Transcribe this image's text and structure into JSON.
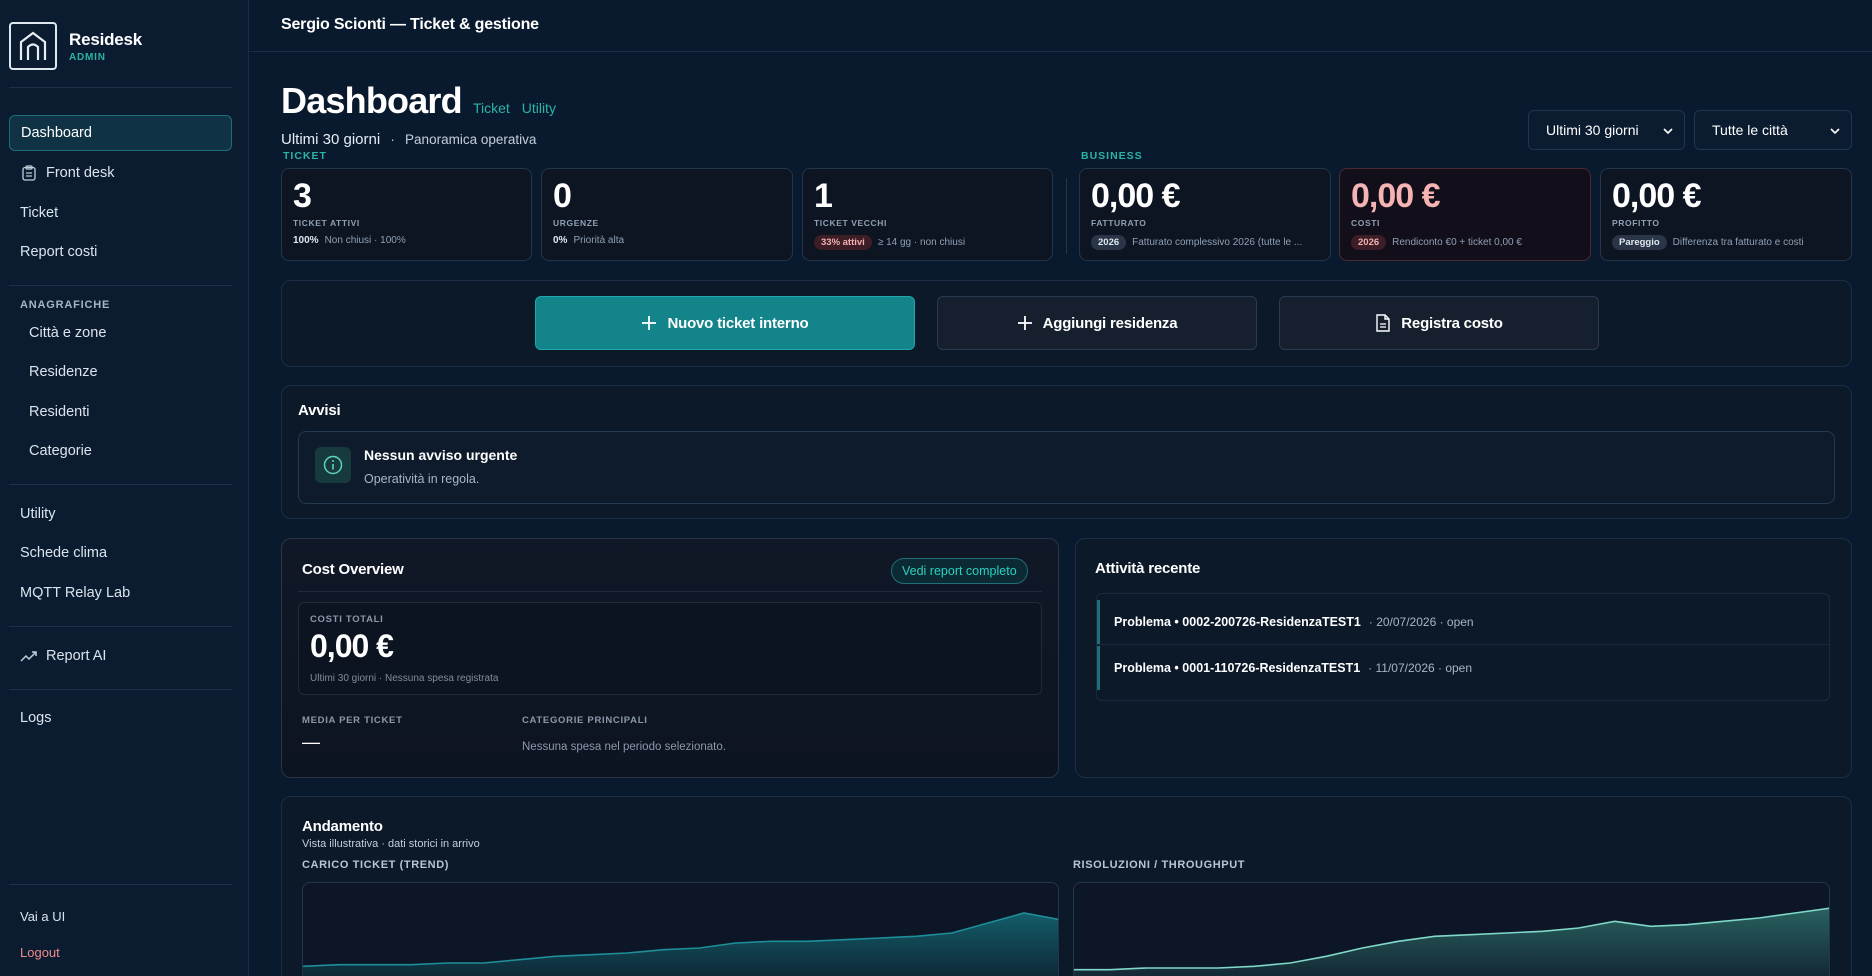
{
  "brand": {
    "name": "Residesk",
    "role": "ADMIN"
  },
  "sidebar": {
    "items": [
      {
        "label": "Dashboard"
      },
      {
        "label": "Front desk"
      },
      {
        "label": "Ticket"
      },
      {
        "label": "Report costi"
      }
    ],
    "anagrafiche_label": "ANAGRAFICHE",
    "anagrafiche": [
      {
        "label": "Città e zone"
      },
      {
        "label": "Residenze"
      },
      {
        "label": "Residenti"
      },
      {
        "label": "Categorie"
      }
    ],
    "utility": [
      {
        "label": "Utility"
      },
      {
        "label": "Schede clima"
      },
      {
        "label": "MQTT Relay Lab"
      }
    ],
    "report_ai": "Report AI",
    "logs": "Logs",
    "vai_ui": "Vai a UI",
    "logout": "Logout"
  },
  "topbar": {
    "title": "Sergio Scionti — Ticket & gestione"
  },
  "header": {
    "title": "Dashboard",
    "links": [
      "Ticket",
      "Utility"
    ],
    "period": "Ultimi 30 giorni",
    "separator": "·",
    "overview": "Panoramica operativa",
    "filter_period": "Ultimi 30 giorni",
    "filter_city": "Tutte le città"
  },
  "sections": {
    "ticket": "TICKET",
    "business": "BUSINESS"
  },
  "kpis": [
    {
      "value": "3",
      "label": "TICKET ATTIVI",
      "strong": "100%",
      "note": "Non chiusi · 100%"
    },
    {
      "value": "0",
      "label": "URGENZE",
      "strong": "0%",
      "note": "Priorità alta"
    },
    {
      "value": "1",
      "label": "TICKET VECCHI",
      "pill": "33% attivi",
      "note": "≥ 14 gg · non chiusi"
    },
    {
      "value": "0,00 €",
      "label": "FATTURATO",
      "pill": "2026",
      "note": "Fatturato complessivo 2026 (tutte le ..."
    },
    {
      "value": "0,00 €",
      "label": "COSTI",
      "pill": "2026",
      "note": "Rendiconto €0 + ticket 0,00 €"
    },
    {
      "value": "0,00 €",
      "label": "PROFITTO",
      "pill": "Pareggio",
      "note": "Differenza tra fatturato e costi"
    }
  ],
  "actions": {
    "new_ticket": "Nuovo ticket interno",
    "add_residence": "Aggiungi residenza",
    "register_cost": "Registra costo"
  },
  "alerts": {
    "title": "Avvisi",
    "item_title": "Nessun avviso urgente",
    "item_text": "Operatività in regola."
  },
  "cost_overview": {
    "title": "Cost Overview",
    "link": "Vedi report completo",
    "total_label": "COSTI TOTALI",
    "total_value": "0,00 €",
    "total_sub": "Ultimi 30 giorni · Nessuna spesa registrata",
    "avg_label": "MEDIA PER TICKET",
    "avg_value": "—",
    "cat_label": "CATEGORIE PRINCIPALI",
    "cat_value": "Nessuna spesa nel periodo selezionato."
  },
  "activity": {
    "title": "Attività recente",
    "rows": [
      {
        "title": "Problema • 0002-200726-ResidenzaTEST1",
        "meta": "· 20/07/2026 · open"
      },
      {
        "title": "Problema • 0001-110726-ResidenzaTEST1",
        "meta": "· 11/07/2026 · open"
      }
    ]
  },
  "trend": {
    "title": "Andamento",
    "subtitle": "Vista illustrativa · dati storici in arrivo",
    "chart1_label": "CARICO TICKET (TREND)",
    "chart2_label": "RISOLUZIONI / THROUGHPUT"
  },
  "colors": {
    "accent": "#2bb3a3",
    "primary_button": "#12848a",
    "danger_text": "#f6b3b3",
    "background": "#0a1a2e"
  },
  "chart_data": [
    {
      "type": "area",
      "title": "CARICO TICKET (TREND)",
      "x": [
        0,
        1,
        2,
        3,
        4,
        5,
        6,
        7,
        8,
        9,
        10,
        11,
        12,
        13,
        14,
        15,
        16,
        17,
        18,
        19,
        20,
        21
      ],
      "values": [
        10,
        11,
        11,
        11,
        12,
        12,
        14,
        16,
        17,
        18,
        20,
        21,
        24,
        25,
        25,
        26,
        27,
        28,
        30,
        36,
        42,
        38
      ],
      "ylim": [
        0,
        60
      ],
      "grid": false
    },
    {
      "type": "area",
      "title": "RISOLUZIONI / THROUGHPUT",
      "x": [
        0,
        1,
        2,
        3,
        4,
        5,
        6,
        7,
        8,
        9,
        10,
        11,
        12,
        13,
        14,
        15,
        16,
        17,
        18,
        19,
        20,
        21
      ],
      "values": [
        8,
        8,
        9,
        9,
        9,
        10,
        12,
        16,
        21,
        25,
        28,
        29,
        30,
        31,
        33,
        37,
        34,
        35,
        37,
        39,
        42,
        45
      ],
      "ylim": [
        0,
        60
      ],
      "grid": false
    }
  ]
}
